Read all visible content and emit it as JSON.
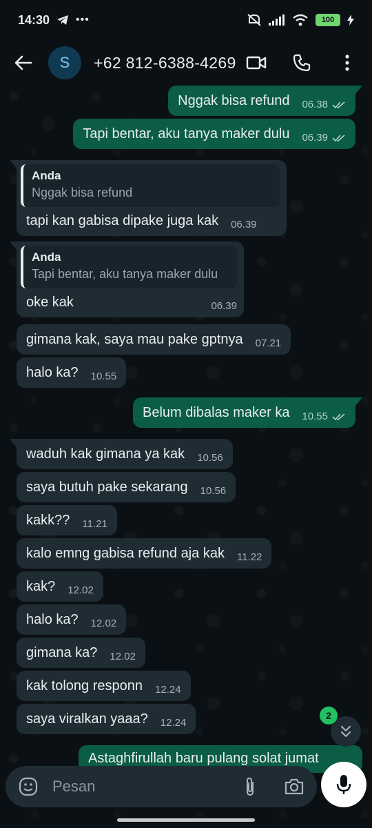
{
  "status_bar": {
    "time": "14:30",
    "battery": "100"
  },
  "header": {
    "avatar_letter": "S",
    "contact": "+62 812-6388-4269"
  },
  "messages": [
    {
      "text": "Nggak bisa refund",
      "time": "06.38"
    },
    {
      "text": "Tapi bentar, aku tanya maker dulu",
      "time": "06.39"
    },
    {
      "quote_name": "Anda",
      "quote_text": "Nggak bisa refund",
      "text": "tapi kan gabisa dipake juga kak",
      "time": "06.39"
    },
    {
      "quote_name": "Anda",
      "quote_text": "Tapi bentar, aku tanya maker dulu",
      "text": "oke kak",
      "time": "06.39"
    },
    {
      "text": "gimana kak, saya mau pake gptnya",
      "time": "07.21"
    },
    {
      "text": "halo ka?",
      "time": "10.55"
    },
    {
      "text": "Belum dibalas maker ka",
      "time": "10.55"
    },
    {
      "text": "waduh kak gimana ya kak",
      "time": "10.56"
    },
    {
      "text": "saya butuh pake sekarang",
      "time": "10.56"
    },
    {
      "text": "kakk??",
      "time": "11.21"
    },
    {
      "text": "kalo emng gabisa refund aja kak",
      "time": "11.22"
    },
    {
      "text": "kak?",
      "time": "12.02"
    },
    {
      "text": "halo ka?",
      "time": "12.02"
    },
    {
      "text": "gimana ka?",
      "time": "12.02"
    },
    {
      "text": "kak tolong responn",
      "time": "12.24"
    },
    {
      "text": "saya viralkan yaaa?",
      "time": "12.24"
    },
    {
      "text": "Astaghfirullah baru pulang solat jumat"
    }
  ],
  "scroll": {
    "unread_count": "2"
  },
  "composer": {
    "placeholder": "Pesan"
  },
  "colors": {
    "incoming": "#1f2c34",
    "outgoing": "#0b5d45",
    "unread_badge": "#21c063",
    "background": "#0b1014"
  },
  "icons": [
    "back-arrow-icon",
    "video-call-icon",
    "phone-icon",
    "more-vertical-icon",
    "emoji-icon",
    "attach-icon",
    "camera-icon",
    "mic-icon",
    "chevron-double-down-icon",
    "double-check-icon"
  ]
}
